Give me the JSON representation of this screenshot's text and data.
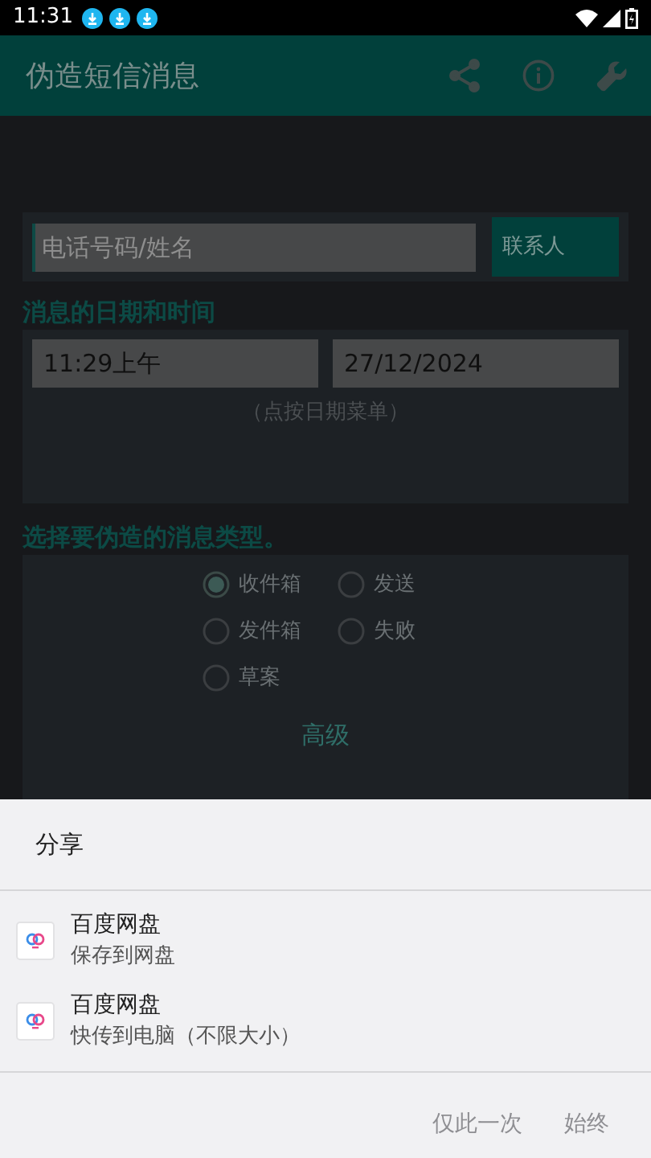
{
  "status_bar": {
    "time": "11:31"
  },
  "app_bar": {
    "title": "伪造短信消息"
  },
  "contact": {
    "placeholder": "电话号码/姓名",
    "button": "联系人"
  },
  "datetime": {
    "heading": "消息的日期和时间",
    "time": "11:29上午",
    "date": "27/12/2024",
    "hint": "（点按日期菜单）"
  },
  "message_type": {
    "heading": "选择要伪造的消息类型。",
    "options": [
      {
        "label": "收件箱",
        "selected": true
      },
      {
        "label": "发送",
        "selected": false
      },
      {
        "label": "发件箱",
        "selected": false
      },
      {
        "label": "失败",
        "selected": false
      },
      {
        "label": "草案",
        "selected": false
      }
    ],
    "advanced": "高级"
  },
  "share_sheet": {
    "title": "分享",
    "items": [
      {
        "app": "百度网盘",
        "action": "保存到网盘"
      },
      {
        "app": "百度网盘",
        "action": "快传到电脑（不限大小）"
      }
    ],
    "buttons": [
      "仅此一次",
      "始终"
    ]
  }
}
